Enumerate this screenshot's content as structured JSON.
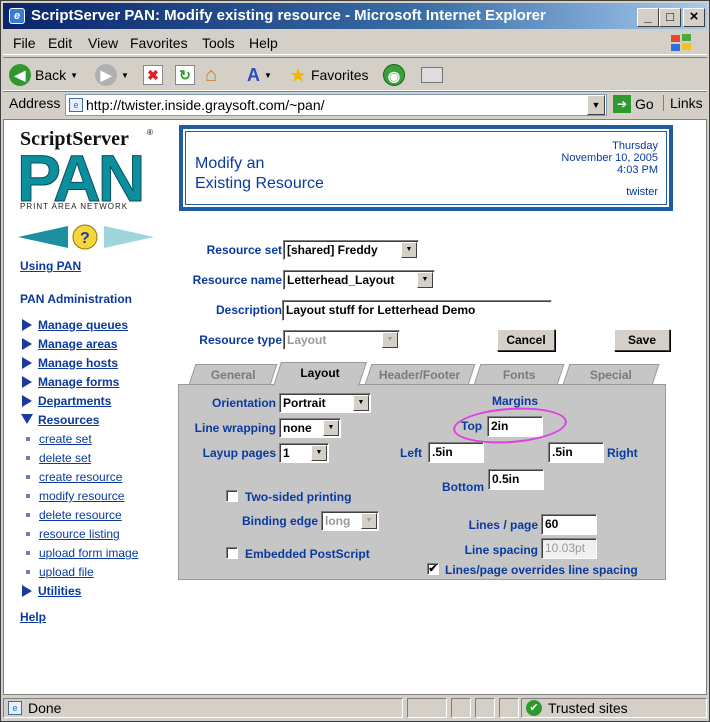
{
  "window": {
    "title": "ScriptServer PAN: Modify existing resource - Microsoft Internet Explorer",
    "minimize": "_",
    "maximize": "□",
    "close": "×"
  },
  "menu": [
    "File",
    "Edit",
    "View",
    "Favorites",
    "Tools",
    "Help"
  ],
  "toolbar": {
    "back": "Back",
    "favorites": "Favorites"
  },
  "address": {
    "label": "Address",
    "url": "http://twister.inside.graysoft.com/~pan/",
    "go": "Go",
    "links": "Links"
  },
  "logo": {
    "top": "ScriptServer",
    "reg": "®",
    "main": "PAN",
    "sub": "PRINT AREA NETWORK"
  },
  "sidebar": {
    "using_pan": "Using PAN",
    "admin": "PAN Administration",
    "items": [
      "Manage queues",
      "Manage areas",
      "Manage hosts",
      "Manage forms",
      "Departments",
      "Resources"
    ],
    "subitems": [
      "create set",
      "delete set",
      "create resource",
      "modify resource",
      "delete resource",
      "resource listing",
      "upload form image",
      "upload file"
    ],
    "utilities": "Utilities",
    "help": "Help"
  },
  "header": {
    "title_line1": "Modify an",
    "title_line2": "Existing Resource",
    "day": "Thursday",
    "date": "November 10, 2005",
    "time": "4:03 PM",
    "user": "twister"
  },
  "form": {
    "resource_set_label": "Resource set",
    "resource_set_value": "[shared] Freddy",
    "resource_name_label": "Resource name",
    "resource_name_value": "Letterhead_Layout",
    "description_label": "Description",
    "description_value": "Layout stuff for Letterhead Demo",
    "resource_type_label": "Resource type",
    "resource_type_value": "Layout",
    "cancel": "Cancel",
    "save": "Save"
  },
  "tabs": [
    "General",
    "Layout",
    "Header/Footer",
    "Fonts",
    "Special"
  ],
  "layout": {
    "orientation_label": "Orientation",
    "orientation_value": "Portrait",
    "line_wrapping_label": "Line wrapping",
    "line_wrapping_value": "none",
    "layup_label": "Layup pages",
    "layup_value": "1",
    "margins_label": "Margins",
    "top_label": "Top",
    "top_value": "2in",
    "left_label": "Left",
    "left_value": ".5in",
    "right_label": "Right",
    "right_value": ".5in",
    "bottom_label": "Bottom",
    "bottom_value": "0.5in",
    "two_sided_label": "Two-sided printing",
    "binding_label": "Binding edge",
    "binding_value": "long",
    "embedded_label": "Embedded PostScript",
    "lines_page_label": "Lines / page",
    "lines_page_value": "60",
    "line_spacing_label": "Line spacing",
    "line_spacing_value": "10.03pt",
    "override_label": "Lines/page overrides line spacing"
  },
  "status": {
    "left": "Done",
    "zone": "Trusted sites"
  }
}
